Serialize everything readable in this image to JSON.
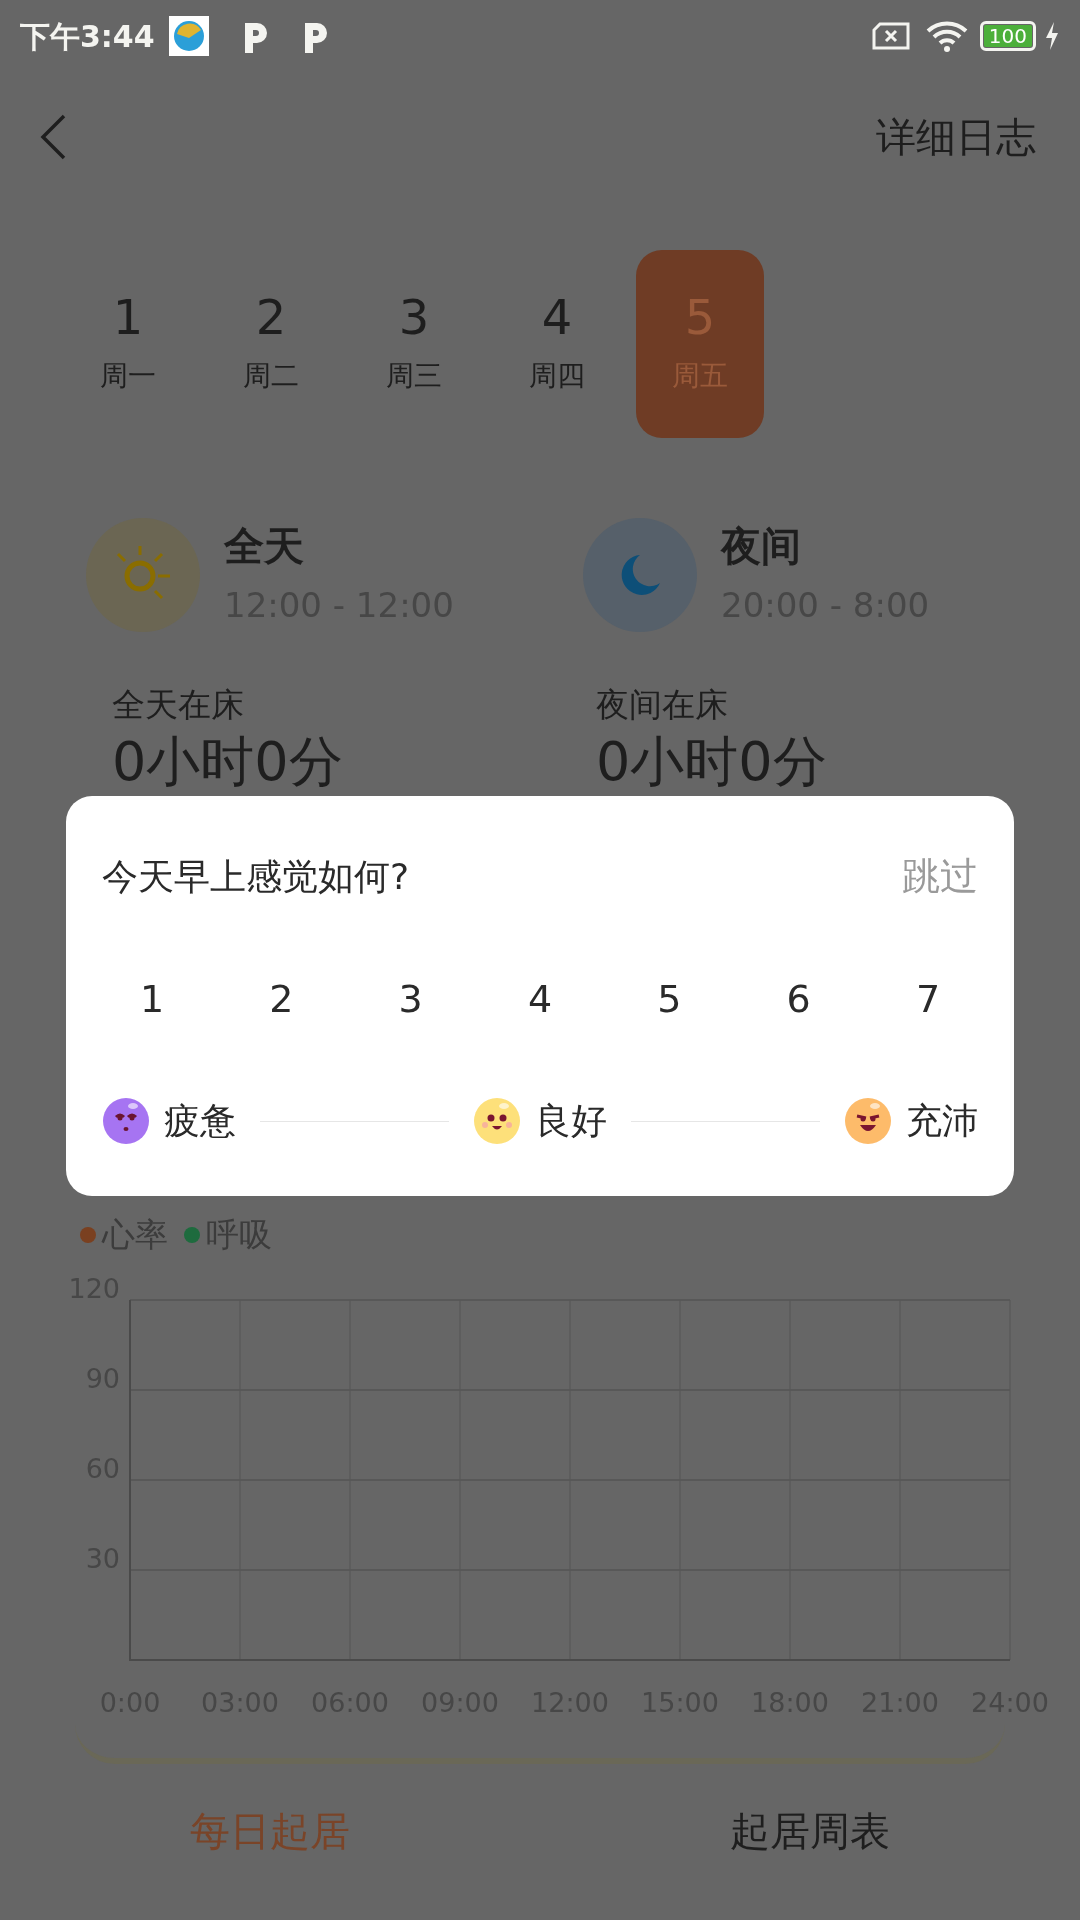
{
  "status_bar": {
    "time": "下午3:44",
    "battery": "100"
  },
  "header": {
    "action": "详细日志"
  },
  "days": [
    {
      "number": "1",
      "weekday": "周一",
      "selected": false
    },
    {
      "number": "2",
      "weekday": "周二",
      "selected": false
    },
    {
      "number": "3",
      "weekday": "周三",
      "selected": false
    },
    {
      "number": "4",
      "weekday": "周四",
      "selected": false
    },
    {
      "number": "5",
      "weekday": "周五",
      "selected": true
    }
  ],
  "periods": [
    {
      "kind": "day",
      "title": "全天",
      "time": "12:00 - 12:00",
      "label": "全天在床",
      "duration": "0小时0分"
    },
    {
      "kind": "night",
      "title": "夜间",
      "time": "20:00 - 8:00",
      "label": "夜间在床",
      "duration": "0小时0分"
    }
  ],
  "chart": {
    "legend": [
      {
        "label": "心率",
        "color": "#7a4020"
      },
      {
        "label": "呼吸",
        "color": "#1e6b3e"
      }
    ],
    "chart_data": {
      "type": "line",
      "grid": true,
      "xlim": [
        0,
        24
      ],
      "ylim": [
        0,
        120
      ],
      "yticks": [
        30,
        60,
        90,
        120
      ],
      "xticks": [
        {
          "value": 0,
          "label": "0:00"
        },
        {
          "value": 3,
          "label": "03:00"
        },
        {
          "value": 6,
          "label": "06:00"
        },
        {
          "value": 9,
          "label": "09:00"
        },
        {
          "value": 12,
          "label": "12:00"
        },
        {
          "value": 15,
          "label": "15:00"
        },
        {
          "value": 18,
          "label": "18:00"
        },
        {
          "value": 21,
          "label": "21:00"
        },
        {
          "value": 24,
          "label": "24:00"
        }
      ]
    }
  },
  "tabs": [
    {
      "label": "每日起居",
      "selected": true
    },
    {
      "label": "起居周表",
      "selected": false
    }
  ],
  "dialog": {
    "title": "今天早上感觉如何?",
    "skip": "跳过",
    "scale": [
      "1",
      "2",
      "3",
      "4",
      "5",
      "6",
      "7"
    ],
    "moods": [
      {
        "kind": "tired",
        "label": "疲惫"
      },
      {
        "kind": "good",
        "label": "良好"
      },
      {
        "kind": "energetic",
        "label": "充沛"
      }
    ]
  }
}
